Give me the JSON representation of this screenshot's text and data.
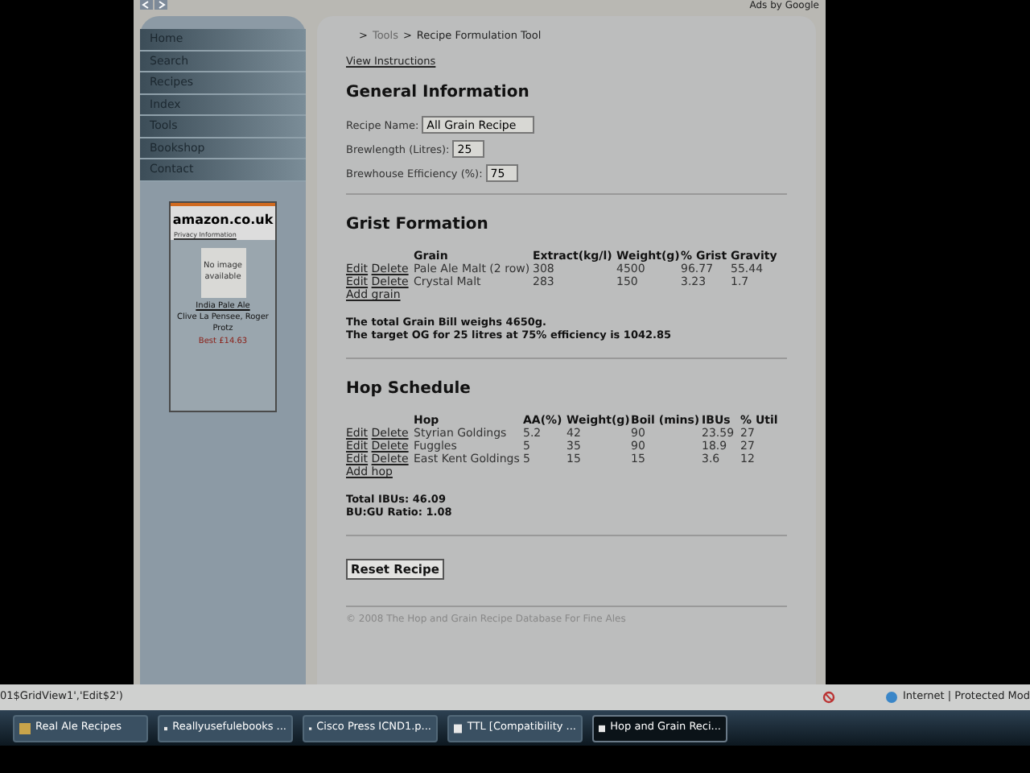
{
  "header": {
    "ads_label": "Ads by Google"
  },
  "sidebar": {
    "items": [
      {
        "label": "Home"
      },
      {
        "label": "Search"
      },
      {
        "label": "Recipes"
      },
      {
        "label": "Index"
      },
      {
        "label": "Tools"
      },
      {
        "label": "Bookshop"
      },
      {
        "label": "Contact"
      }
    ],
    "ad": {
      "brand": "amazon.co.uk",
      "privacy": "Privacy Information",
      "image_text": "No image available",
      "title": "India Pale Ale",
      "author": "Clive La Pensee, Roger Protz",
      "price": "Best £14.63"
    }
  },
  "breadcrumb": [
    {
      "label": ">",
      "link": false
    },
    {
      "label": "Tools",
      "link": true
    },
    {
      "label": ">",
      "link": false
    },
    {
      "label": "Recipe Formulation Tool",
      "link": false
    }
  ],
  "instructions_link": "View Instructions",
  "general": {
    "title": "General Information",
    "fields": [
      {
        "label": "Recipe Name:",
        "value": "All Grain Recipe"
      },
      {
        "label": "Brewlength (Litres):",
        "value": "25"
      },
      {
        "label": "Brewhouse Efficiency (%):",
        "value": "75"
      }
    ]
  },
  "grist": {
    "title": "Grist Formation",
    "columns": [
      "Grain",
      "Extract(kg/l)",
      "Weight(g)",
      "% Grist",
      "Gravity"
    ],
    "rows": [
      {
        "edit": "Edit",
        "delete": "Delete",
        "cells": [
          "Pale Ale Malt (2 row)",
          "308",
          "4500",
          "96.77",
          "55.44"
        ]
      },
      {
        "edit": "Edit",
        "delete": "Delete",
        "cells": [
          "Crystal Malt",
          "283",
          "150",
          "3.23",
          "1.7"
        ]
      }
    ],
    "add_link": "Add grain",
    "summary": [
      "The total Grain Bill weighs 4650g.",
      "The target OG for 25 litres at 75% efficiency is 1042.85"
    ]
  },
  "hops": {
    "title": "Hop Schedule",
    "columns": [
      "Hop",
      "AA(%)",
      "Weight(g)",
      "Boil (mins)",
      "IBUs",
      "% Util"
    ],
    "rows": [
      {
        "edit": "Edit",
        "delete": "Delete",
        "cells": [
          "Styrian Goldings",
          "5.2",
          "42",
          "90",
          "23.59",
          "27"
        ]
      },
      {
        "edit": "Edit",
        "delete": "Delete",
        "cells": [
          "Fuggles",
          "5",
          "35",
          "90",
          "18.9",
          "27"
        ]
      },
      {
        "edit": "Edit",
        "delete": "Delete",
        "cells": [
          "East Kent Goldings",
          "5",
          "15",
          "15",
          "3.6",
          "12"
        ]
      }
    ],
    "add_link": "Add hop",
    "summary": [
      "Total IBUs: 46.09",
      "BU:GU Ratio: 1.08"
    ]
  },
  "reset_button": "Reset Recipe",
  "footer": "© 2008 The Hop and Grain Recipe Database For Fine Ales",
  "status_bar": {
    "text": "01$GridView1','Edit$2')",
    "zone": "Internet | Protected Mod"
  },
  "taskbar": [
    {
      "label": "Real Ale Recipes",
      "selected": false
    },
    {
      "label": "Reallyusefulebooks ...",
      "selected": false
    },
    {
      "label": "Cisco Press ICND1.p...",
      "selected": false
    },
    {
      "label": "TTL [Compatibility ...",
      "selected": false
    },
    {
      "label": "Hop and Grain Reci...",
      "selected": true
    }
  ]
}
